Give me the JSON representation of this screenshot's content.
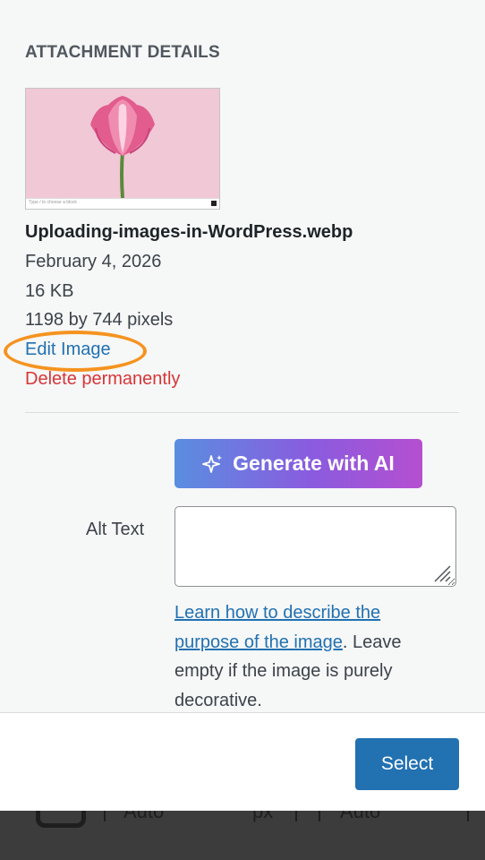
{
  "attachment": {
    "heading": "ATTACHMENT DETAILS",
    "thumbnail_caption": "Type / to choose a block",
    "filename": "Uploading-images-in-WordPress.webp",
    "date": "February 4, 2026",
    "file_size": "16 KB",
    "dimensions": "1198 by 744 pixels",
    "edit_label": "Edit Image",
    "delete_label": "Delete permanently"
  },
  "ai": {
    "button_label": "Generate with AI",
    "icon": "sparkles-icon"
  },
  "alt_text": {
    "label": "Alt Text",
    "value": "",
    "help_link": "Learn how to describe the purpose of the image",
    "help_suffix": ". Leave empty if the image is purely decorative."
  },
  "toolbar": {
    "select_label": "Select"
  },
  "background_editor": {
    "left_value": "Auto",
    "unit": "px",
    "right_value": "Auto"
  },
  "colors": {
    "link": "#2271b1",
    "danger": "#d63638",
    "primary_button": "#2271b1",
    "highlight_ring": "#f5931f",
    "ai_gradient": [
      "#5a8ee0",
      "#b54fd0"
    ]
  }
}
